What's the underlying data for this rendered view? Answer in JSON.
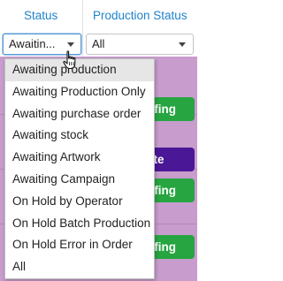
{
  "header": {
    "status_label": "Status",
    "production_status_label": "Production Status"
  },
  "filters": {
    "status_value": "Awaitin...",
    "production_status_value": "All"
  },
  "rows": [
    {
      "button_label": "ofing",
      "button_color": "#26a541"
    },
    {
      "button_label": "ete",
      "button_color": "#4a1796"
    },
    {
      "button_label": "ofing",
      "button_color": "#26a541"
    },
    {
      "button_label": "ofing",
      "button_color": "#26a541"
    }
  ],
  "dropdown": {
    "options": [
      "Awaiting production",
      "Awaiting Production Only",
      "Awaiting purchase order",
      "Awaiting stock",
      "Awaiting Artwork",
      "Awaiting Campaign",
      "On Hold by Operator",
      "On Hold Batch Production",
      "On Hold Error in Order",
      "All"
    ],
    "highlighted_index": 0
  },
  "colors": {
    "header_text": "#1f83c9",
    "row_background": "#c89ccd",
    "green_button": "#26a541",
    "purple_button": "#4a1796"
  },
  "icons": {
    "cursor": "hand-pointer-icon",
    "dropdown_arrow": "chevron-down-icon"
  }
}
